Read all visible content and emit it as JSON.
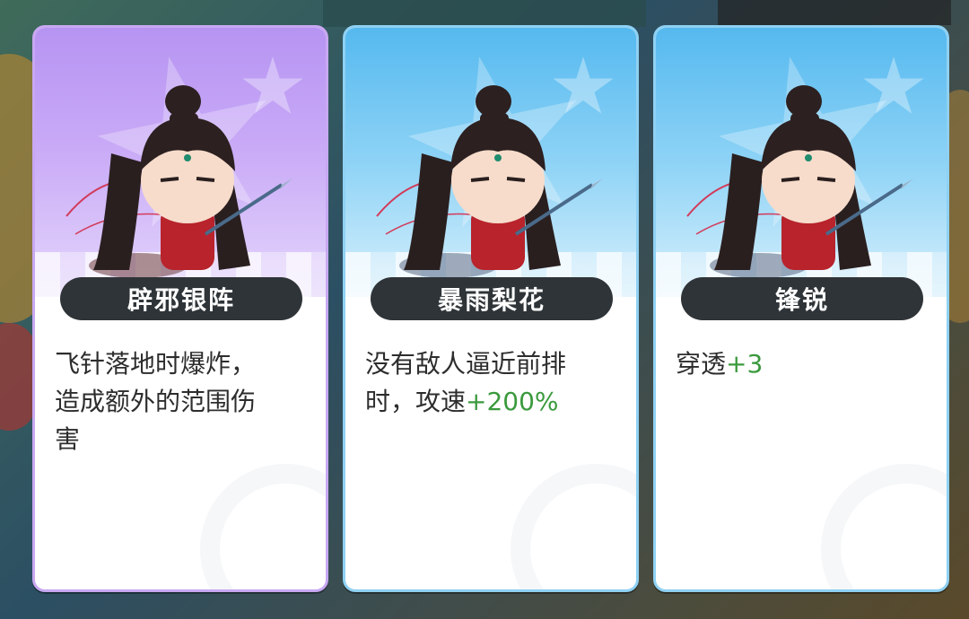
{
  "cards": [
    {
      "theme": "purple",
      "title": "辟邪银阵",
      "desc_lines": [
        "飞针落地时爆炸，",
        "造成额外的范围伤",
        "害"
      ],
      "bonus": ""
    },
    {
      "theme": "blue",
      "title": "暴雨梨花",
      "desc_lines": [
        "没有敌人逼近前排",
        "时，攻速"
      ],
      "bonus": "+200%"
    },
    {
      "theme": "blue",
      "title": "锋锐",
      "desc_lines": [
        "穿透"
      ],
      "bonus": "+3"
    }
  ],
  "colors": {
    "purple_accent": "#c8a8f2",
    "blue_accent": "#8fd1f3",
    "bonus_green": "#3a9a3d",
    "plate_dark": "#2f3438"
  },
  "icons": [
    "hero-portrait-icon",
    "star-icon",
    "sparkle-icon"
  ]
}
